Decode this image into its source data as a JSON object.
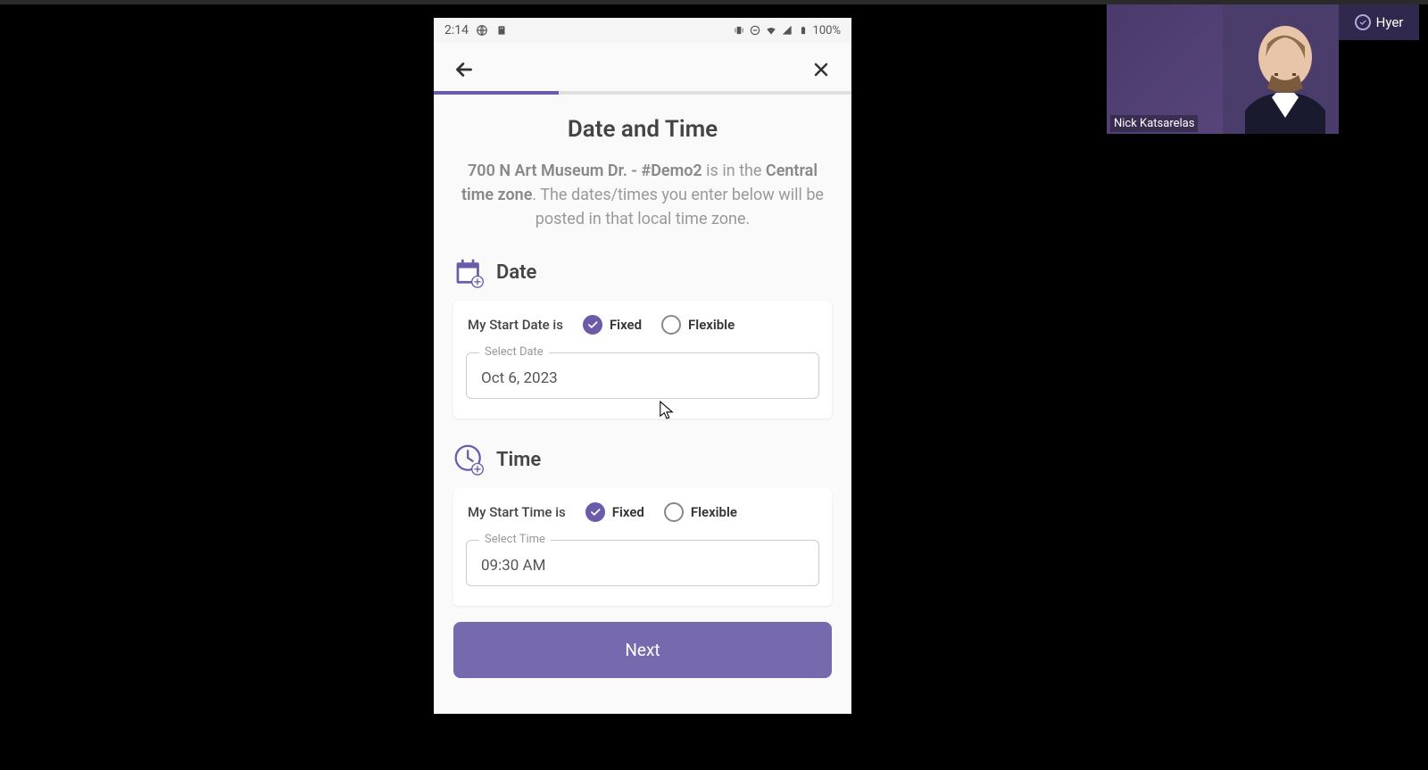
{
  "statusBar": {
    "time": "2:14",
    "battery": "100%"
  },
  "progress": {
    "percent": 30
  },
  "page": {
    "title": "Date and Time",
    "location": "700 N Art Museum Dr. - #Demo2",
    "locationSuffix": " is in the ",
    "timezone": "Central time zone",
    "timezoneSuffix": ". The dates/times you enter below will be posted in that local time zone."
  },
  "dateSection": {
    "title": "Date",
    "label": "My Start Date is",
    "fixedOption": "Fixed",
    "flexibleOption": "Flexible",
    "inputLabel": "Select Date",
    "inputValue": "Oct 6, 2023"
  },
  "timeSection": {
    "title": "Time",
    "label": "My Start Time is",
    "fixedOption": "Fixed",
    "flexibleOption": "Flexible",
    "inputLabel": "Select Time",
    "inputValue": "09:30 AM"
  },
  "nextButton": "Next",
  "speaker": {
    "name": "Nick Katsarelas",
    "brand": "Hyer"
  }
}
